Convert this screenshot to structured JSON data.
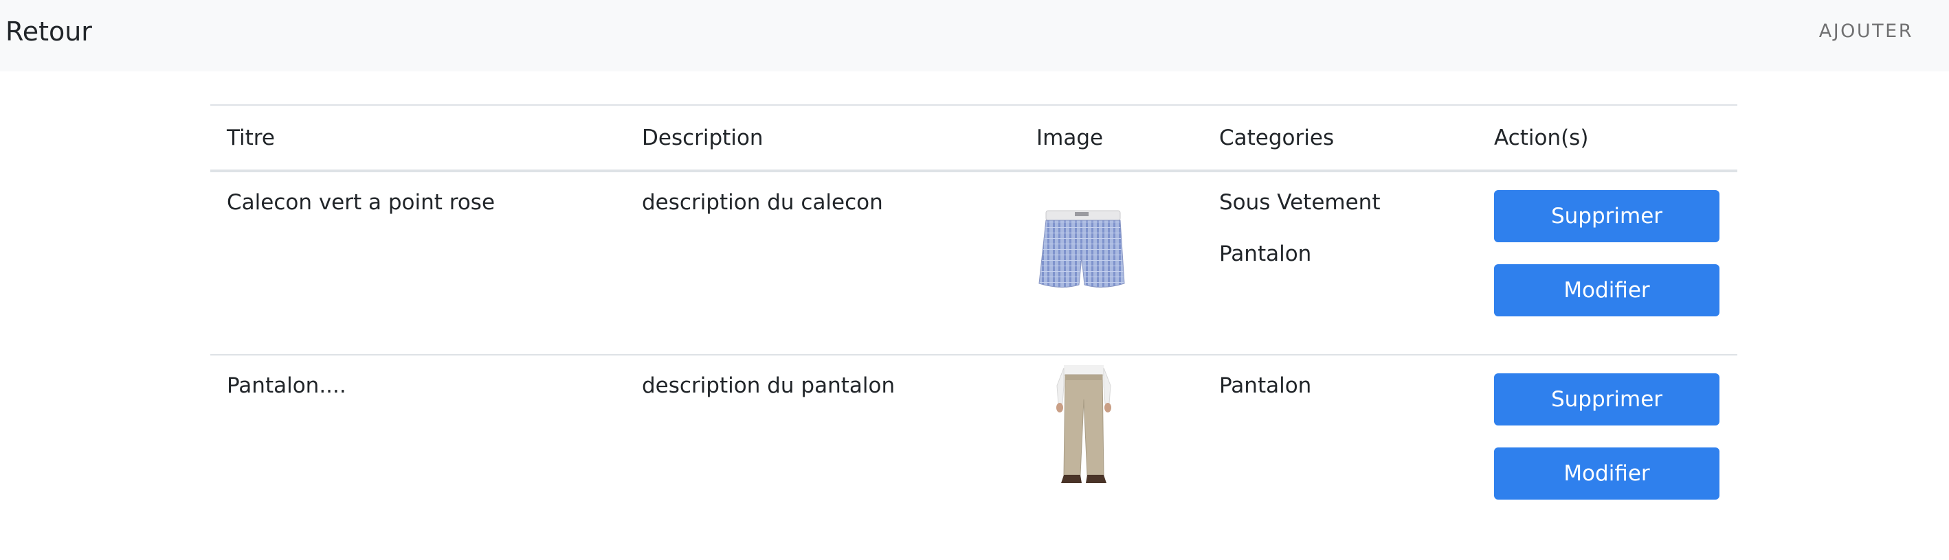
{
  "navbar": {
    "brand": "Retour",
    "add_link": "AJOUTER"
  },
  "table": {
    "headers": [
      "Titre",
      "Description",
      "Image",
      "Categories",
      "Action(s)"
    ],
    "rows": [
      {
        "title": "Calecon vert a point rose",
        "description": "description du calecon",
        "image": "boxer-shorts-image",
        "categories": [
          "Sous Vetement",
          "Pantalon"
        ],
        "delete_label": "Supprimer",
        "edit_label": "Modifier"
      },
      {
        "title": "Pantalon....",
        "description": "description du pantalon",
        "image": "trousers-image",
        "categories": [
          "Pantalon"
        ],
        "delete_label": "Supprimer",
        "edit_label": "Modifier"
      }
    ]
  },
  "colors": {
    "navbar_bg": "#f8f9fa",
    "button_bg": "#2f80ed",
    "button_text": "#ffffff",
    "border": "#dee2e6"
  }
}
